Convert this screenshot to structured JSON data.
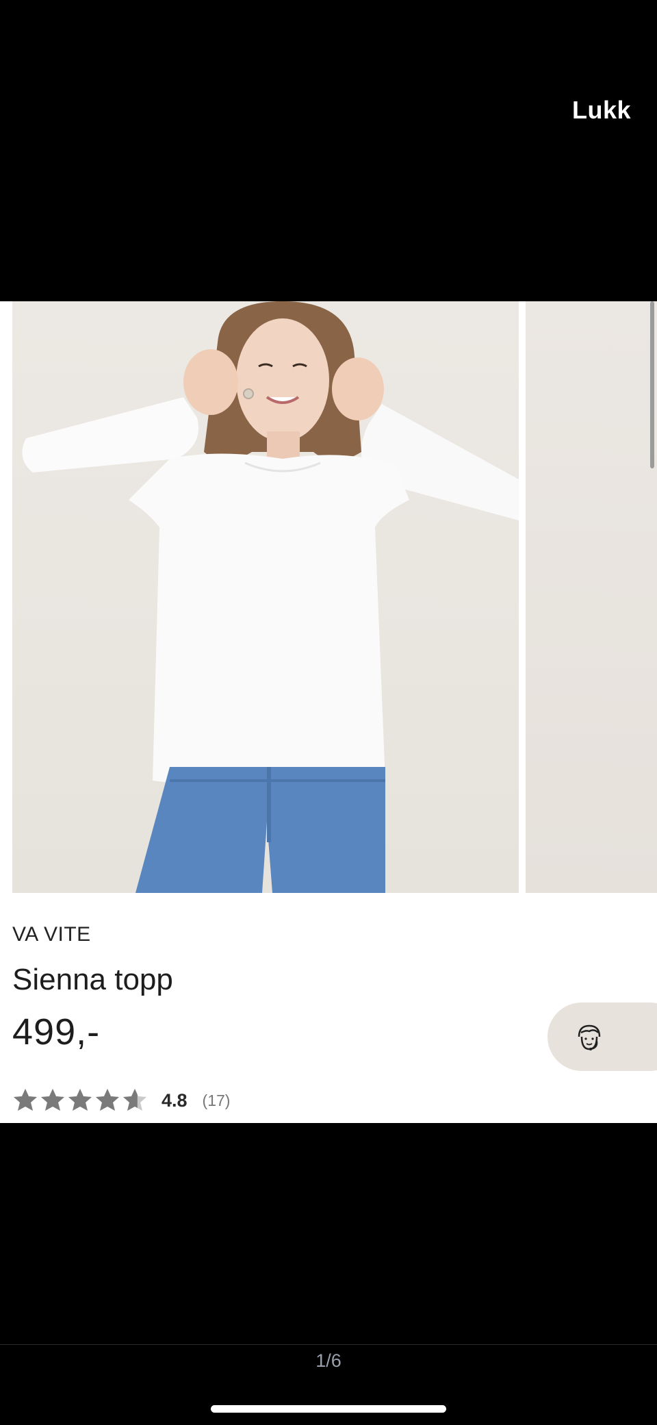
{
  "viewer": {
    "close_label": "Lukk",
    "pager": "1/6"
  },
  "product": {
    "brand": "VA VITE",
    "title": "Sienna topp",
    "price": "499,-",
    "rating_value": "4.8",
    "rating_count": "(17)",
    "rating_stars": 4.8,
    "rating_max": 5
  },
  "gallery": {
    "image_main": "woman-in-white-long-sleeve-top-and-jeans",
    "image_next": "next-product-image"
  },
  "support": {
    "icon": "customer-support-agent-icon"
  },
  "colors": {
    "star_filled": "#7a7a7a",
    "star_empty": "#c9c9c9",
    "support_bg": "#e8e2dc"
  }
}
